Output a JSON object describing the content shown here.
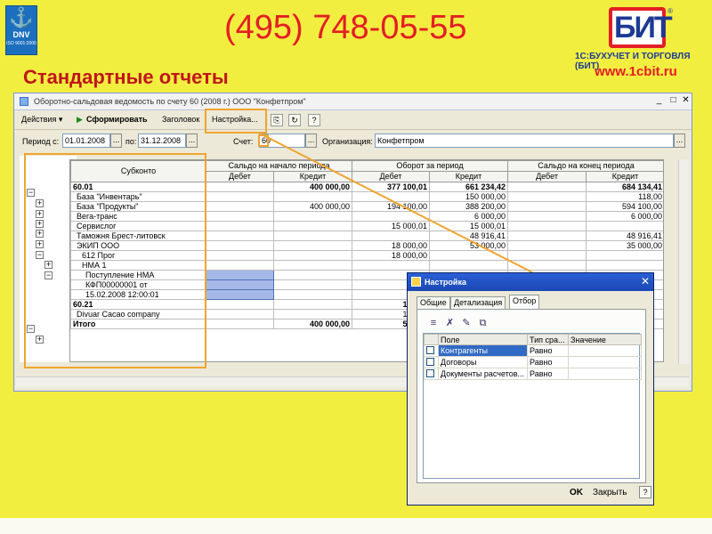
{
  "slide": {
    "phone": "(495) 748-05-55",
    "title": "Стандартные отчеты",
    "dnv_logo_text": "DNV",
    "dnv_iso": "ISO 9001:2000",
    "brand_logo": "БИТ",
    "company": "1С:БУХУЧЕТ И ТОРГОВЛЯ (БИТ)",
    "site": "www.1cbit.ru",
    "accent_color": "#e31e24",
    "background_color": "#f2ee3f",
    "highlight_color": "#f0a42f"
  },
  "window": {
    "title": "Оборотно-сальдовая ведомость по счету 60 (2008 г.) ООО \"Конфетпром\"",
    "toolbar": {
      "actions": "Действия ▾",
      "generate": "Сформировать",
      "header": "Заголовок",
      "settings": "Настройка...",
      "help": "?"
    },
    "period": {
      "label_from": "Период с:",
      "from": "01.01.2008",
      "label_to": "по:",
      "to": "31.12.2008",
      "label_account": "Счет:",
      "account": "60",
      "label_org": "Организация:",
      "org": "Конфетпром",
      "dots": "..."
    },
    "grid": {
      "headers": {
        "subconto": "Субконто",
        "opening": "Сальдо на начало периода",
        "turnover": "Оборот за период",
        "closing": "Сальдо на конец периода",
        "debit": "Дебет",
        "credit": "Кредит"
      },
      "rows": [
        {
          "name": "60.01",
          "od": "",
          "oc": "400 000,00",
          "td": "377 100,01",
          "tc": "661 234,42",
          "cd": "",
          "cc": "684 134,41",
          "bold": true
        },
        {
          "name": "База \"Инвентарь\"",
          "od": "",
          "oc": "",
          "td": "",
          "tc": "150 000,00",
          "cd": "",
          "cc": "118,00"
        },
        {
          "name": "База \"Продукты\"",
          "od": "",
          "oc": "400 000,00",
          "td": "194 100,00",
          "tc": "388 200,00",
          "cd": "",
          "cc": "594 100,00"
        },
        {
          "name": "Вега-транс",
          "od": "",
          "oc": "",
          "td": "",
          "tc": "6 000,00",
          "cd": "",
          "cc": "6 000,00"
        },
        {
          "name": "Сервислог",
          "od": "",
          "oc": "",
          "td": "15 000,01",
          "tc": "15 000,01",
          "cd": "",
          "cc": ""
        },
        {
          "name": "Таможня Брест-литовск",
          "od": "",
          "oc": "",
          "td": "",
          "tc": "48 916,41",
          "cd": "",
          "cc": "48 916,41"
        },
        {
          "name": "ЭКИП ООО",
          "od": "",
          "oc": "",
          "td": "18 000,00",
          "tc": "53 000,00",
          "cd": "",
          "cc": "35 000,00"
        },
        {
          "name": "612 Прог",
          "od": "",
          "oc": "",
          "td": "18 000,00",
          "tc": "",
          "cd": "",
          "cc": ""
        },
        {
          "name": "НМА 1",
          "od": "",
          "oc": "",
          "td": "",
          "tc": "",
          "cd": "",
          "cc": ""
        },
        {
          "name": "Поступление НМА",
          "od": "",
          "oc": "",
          "td": "",
          "tc": "",
          "cd": "",
          "cc": ""
        },
        {
          "name": "КФП00000001 от",
          "od": "",
          "oc": "",
          "td": "",
          "tc": "",
          "cd": "",
          "cc": ""
        },
        {
          "name": "15.02.2008 12:00:01",
          "od": "",
          "oc": "",
          "td": "",
          "tc": "",
          "cd": "",
          "cc": ""
        },
        {
          "name": "60.21",
          "od": "",
          "oc": "",
          "td": "173 29",
          "tc": "",
          "cd": "",
          "cc": "",
          "bold": true
        },
        {
          "name": "Divuar Cacao company",
          "od": "",
          "oc": "",
          "td": "173 29",
          "tc": "",
          "cd": "",
          "cc": ""
        },
        {
          "name": "Итого",
          "od": "",
          "oc": "400 000,00",
          "td": "550 39",
          "tc": "",
          "cd": "",
          "cc": "",
          "bold": true
        }
      ]
    }
  },
  "dialog": {
    "title": "Настройка",
    "tabs": [
      "Общие",
      "Детализация",
      "Отбор"
    ],
    "columns": [
      "Поле",
      "Тип сра...",
      "Значение"
    ],
    "rows": [
      {
        "field": "Контрагенты",
        "type": "Равно",
        "value": ""
      },
      {
        "field": "Договоры",
        "type": "Равно",
        "value": ""
      },
      {
        "field": "Документы расчетов...",
        "type": "Равно",
        "value": ""
      }
    ],
    "ok": "OK",
    "close": "Закрыть",
    "help": "?"
  }
}
